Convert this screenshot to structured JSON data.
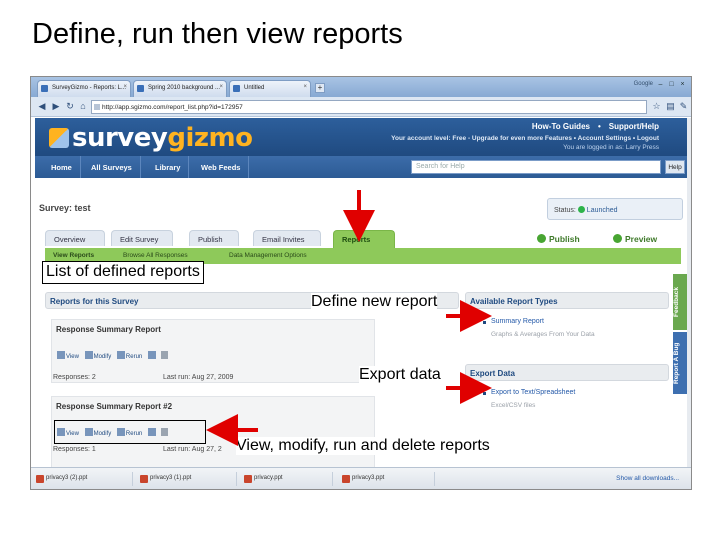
{
  "slide": {
    "title": "Define, run then view reports"
  },
  "browser": {
    "tabs": [
      {
        "label": "SurveyGizmo - Reports: L..."
      },
      {
        "label": "Spring 2010 background ..."
      },
      {
        "label": "Untitled"
      }
    ],
    "new_tab": "+",
    "window_text": "Google",
    "url": "http://app.sgizmo.com/report_list.php?id=172957"
  },
  "site": {
    "logo_a": "survey",
    "logo_b": "gizmo",
    "header_links": [
      "How-To Guides",
      "•",
      "Support/Help"
    ],
    "account_line": "Your account level: Free - Upgrade for even more Features  •  Account Settings  •  Logout",
    "logged_in": "You are logged in as: Larry Press",
    "nav": [
      "Home",
      "All Surveys",
      "Library",
      "Web Feeds"
    ],
    "search_placeholder": "Search for Help",
    "search_button": "Help"
  },
  "survey": {
    "title": "Survey: test",
    "status_label": "Status:",
    "status_value": "Launched",
    "tabs": [
      "Overview",
      "Edit Survey",
      "Publish",
      "Email Invites",
      "Reports"
    ],
    "active_tab": "Reports",
    "publish_action": "Publish",
    "preview_action": "Preview",
    "subnav": [
      "View Reports",
      "Browse All Responses",
      "Data Management Options"
    ]
  },
  "reports": {
    "panel_title": "Reports for this Survey",
    "items": [
      {
        "name": "Response Summary Report",
        "responses": "Responses: 2",
        "last_run": "Last run: Aug 27, 2009"
      },
      {
        "name": "Response Summary Report #2",
        "responses": "Responses: 1",
        "last_run": "Last run: Aug 27, 2"
      }
    ],
    "ops": [
      "View",
      "Modify",
      "Rerun"
    ]
  },
  "available": {
    "title": "Available Report Types",
    "link": "Summary Report",
    "sub": "Graphs & Averages From Your Data"
  },
  "export": {
    "title": "Export Data",
    "link": "Export to Text/Spreadsheet",
    "sub": "Excel/CSV files"
  },
  "side_tabs": [
    "Feedback",
    "Report A Bug"
  ],
  "taskbar": {
    "items": [
      "privacy3 (2).ppt",
      "privacy3 (1).ppt",
      "privacy.ppt",
      "privacy3.ppt"
    ],
    "show_all": "Show all downloads..."
  },
  "annotations": {
    "list": "List of defined reports",
    "define": "Define new report",
    "export": "Export data",
    "ops": "View, modify, run and delete reports"
  },
  "colors": {
    "annotation_arrow": "#e00000",
    "accent_green": "#8ec95a",
    "header_blue": "#2d5f9c"
  }
}
